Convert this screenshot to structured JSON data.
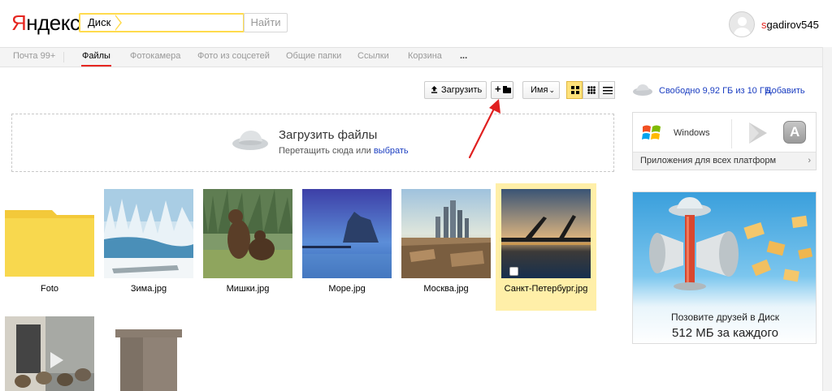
{
  "header": {
    "logo_first": "Я",
    "logo_rest": "ндекс",
    "search_tag": "Диск",
    "search_value": "",
    "search_button": "Найти",
    "user_first": "s",
    "user_rest": "gadirov545"
  },
  "nav": {
    "items": [
      {
        "label": "Почта 99+"
      },
      {
        "label": "Файлы",
        "active": true
      },
      {
        "label": "Фотокамера"
      },
      {
        "label": "Фото из соцсетей"
      },
      {
        "label": "Общие папки"
      },
      {
        "label": "Ссылки"
      },
      {
        "label": "Корзина"
      },
      {
        "label": "..."
      }
    ]
  },
  "toolbar": {
    "upload_label": "Загрузить",
    "new_folder_plus": "+",
    "sort_label": "Имя",
    "sort_chevron": "⌄",
    "view_modes": [
      {
        "name": "large-grid",
        "selected": true
      },
      {
        "name": "small-grid",
        "selected": false
      },
      {
        "name": "list",
        "selected": false
      }
    ]
  },
  "dropzone": {
    "title": "Загрузить файлы",
    "subtitle": "Перетащить сюда или",
    "link": "выбрать"
  },
  "files": [
    {
      "name": "Foto",
      "type": "folder"
    },
    {
      "name": "Зима.jpg",
      "type": "image"
    },
    {
      "name": "Мишки.jpg",
      "type": "image"
    },
    {
      "name": "Море.jpg",
      "type": "image"
    },
    {
      "name": "Москва.jpg",
      "type": "image"
    },
    {
      "name": "Санкт-Петербург.jpg",
      "type": "image",
      "selected": true
    }
  ],
  "sidebar": {
    "storage_text": "Свободно 9,92 ГБ из 10 ГБ.",
    "storage_add": "Добавить",
    "apps_windows": "Windows",
    "apps_footer": "Приложения для всех платформ",
    "apps_chevron": "›",
    "ad_line1": "Позовите друзей в Диск",
    "ad_line2": "512 МБ за каждого"
  },
  "colors": {
    "accent_red": "#e52620",
    "link_blue": "#1a3dc1",
    "selection_yellow": "#ffefa8",
    "search_border": "#ffdb4d"
  }
}
